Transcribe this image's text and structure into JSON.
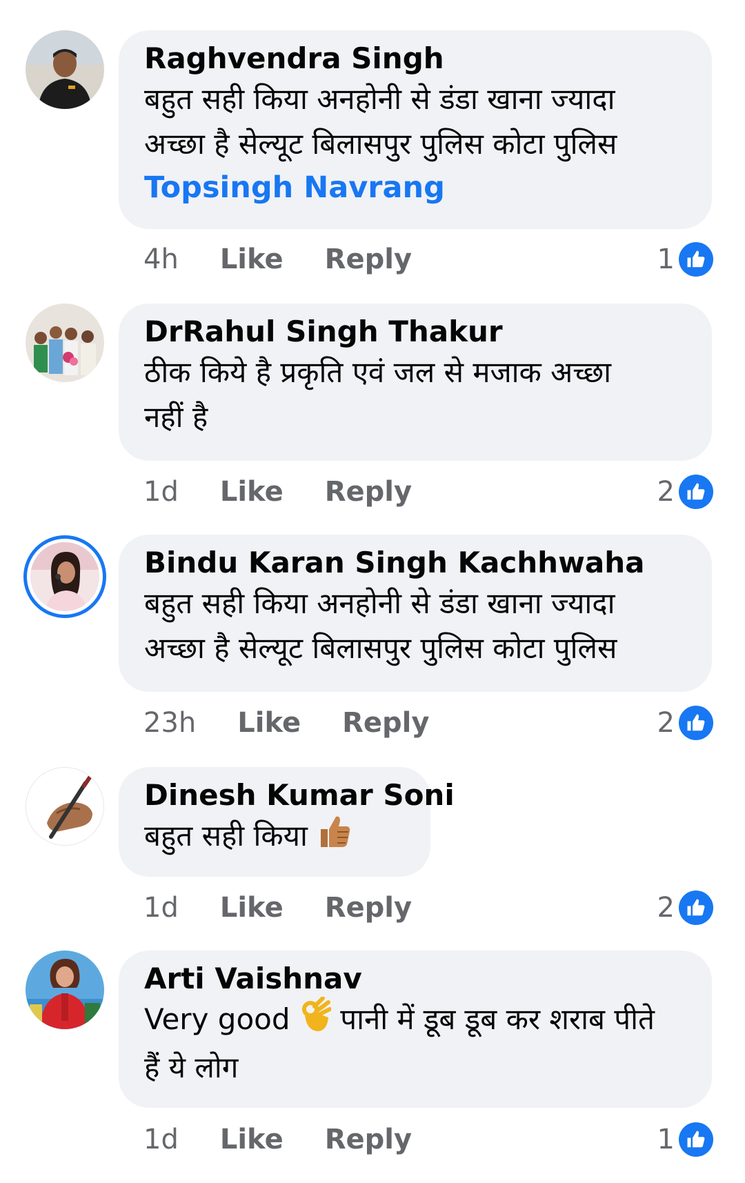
{
  "comments": [
    {
      "author": "Raghvendra Singh",
      "line1": "बहुत सही किया अनहोनी से डंडा खाना ज्यादा",
      "line2": "अच्छा है सेल्यूट बिलासपुर पुलिस कोटा पुलिस",
      "mention": "Topsingh Navrang",
      "time": "4h",
      "like_label": "Like",
      "reply_label": "Reply",
      "reactions": "1"
    },
    {
      "author": "DrRahul Singh Thakur",
      "line1": "ठीक किये है प्रकृति एवं जल से मजाक अच्छा",
      "line2": "नहीं है",
      "time": "1d",
      "like_label": "Like",
      "reply_label": "Reply",
      "reactions": "2"
    },
    {
      "author": "Bindu Karan Singh Kachhwaha",
      "line1": "बहुत सही किया अनहोनी से डंडा खाना ज्यादा",
      "line2": "अच्छा है सेल्यूट बिलासपुर पुलिस कोटा पुलिस",
      "time": "23h",
      "like_label": "Like",
      "reply_label": "Reply",
      "reactions": "2"
    },
    {
      "author": "Dinesh Kumar Soni",
      "line1": "बहुत सही किया",
      "emoji": "thumbs-up-emoji",
      "time": "1d",
      "like_label": "Like",
      "reply_label": "Reply",
      "reactions": "2"
    },
    {
      "author": "Arti Vaishnav",
      "line1_a": "Very good",
      "emoji": "ok-hand-emoji",
      "line1_b": "पानी में डूब डूब कर शराब पीते",
      "line2": "हैं ये लोग",
      "time": "1d",
      "like_label": "Like",
      "reply_label": "Reply",
      "reactions": "1"
    }
  ],
  "colors": {
    "bubble": "#f0f2f5",
    "link": "#1877f2",
    "meta": "#65676b",
    "like_badge": "#1877f2"
  }
}
